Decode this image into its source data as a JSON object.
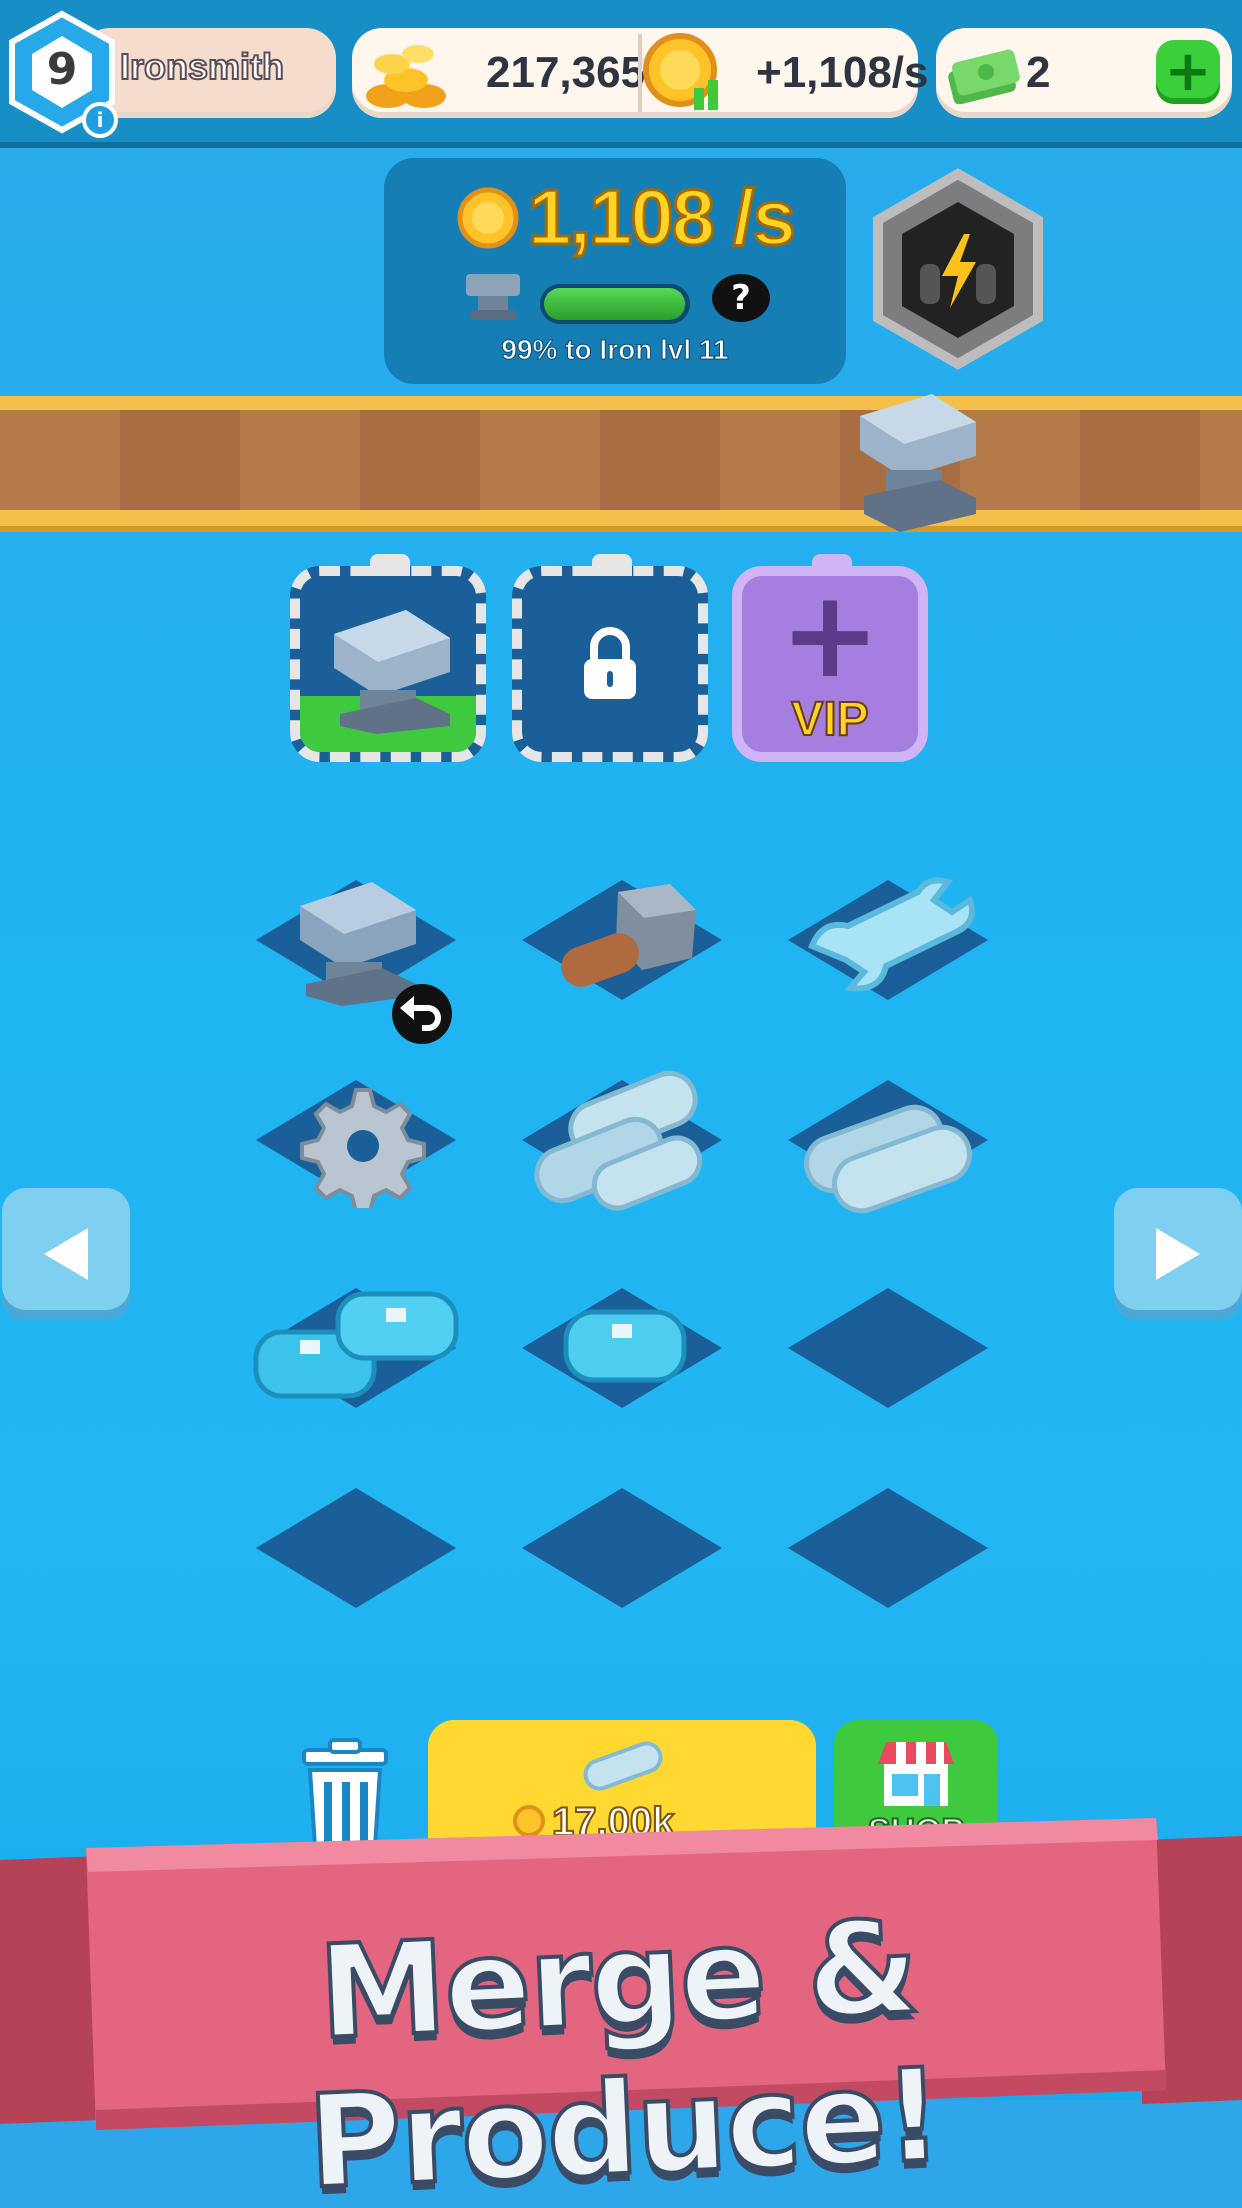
{
  "player": {
    "level": "9",
    "name": "Ironsmith",
    "info": "i"
  },
  "currency": {
    "coins": "217,365",
    "income": "+1,108/s",
    "cash": "2",
    "add": "+"
  },
  "production": {
    "rate": "1,108 /s",
    "progress_label": "99% to Iron lvl 11",
    "progress_fraction": 0.99,
    "help": "?"
  },
  "machines": {
    "vip_label": "VIP",
    "vip_plus": "+"
  },
  "grid": {
    "items": [
      "anvil",
      "hammer",
      "wrench",
      "gear",
      "pipes",
      "pipes",
      "ingots",
      "ingot",
      "empty",
      "empty",
      "empty",
      "empty"
    ]
  },
  "actions": {
    "buy_price": "17.00k",
    "shop_label": "SHOP"
  },
  "banner": {
    "title": "Merge & Produce!"
  },
  "colors": {
    "coin": "#ffd426",
    "green": "#3fc93f",
    "vip": "#a57ee0",
    "banner": "#e3657f",
    "sky": "#22b6f3"
  }
}
